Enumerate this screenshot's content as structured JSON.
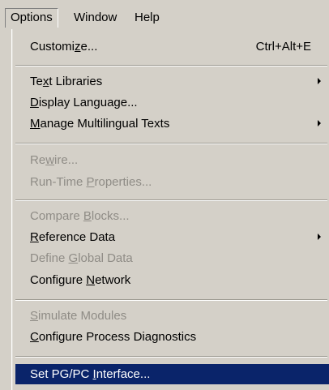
{
  "menubar": {
    "items": [
      "Options",
      "Window",
      "Help"
    ]
  },
  "menu": {
    "customize": {
      "pre": "Customi",
      "acc": "z",
      "post": "e...",
      "shortcut": "Ctrl+Alt+E"
    },
    "text_libraries": {
      "pre": "Te",
      "acc": "x",
      "post": "t Libraries"
    },
    "display_language": {
      "pre": "",
      "acc": "D",
      "post": "isplay Language..."
    },
    "manage_multilingual": {
      "pre": "",
      "acc": "M",
      "post": "anage Multilingual Texts"
    },
    "rewire": {
      "pre": "Re",
      "acc": "w",
      "post": "ire..."
    },
    "run_time_properties": {
      "pre": "Run-Time ",
      "acc": "P",
      "post": "roperties..."
    },
    "compare_blocks": {
      "pre": "Compare ",
      "acc": "B",
      "post": "locks..."
    },
    "reference_data": {
      "pre": "",
      "acc": "R",
      "post": "eference Data"
    },
    "define_global_data": {
      "pre": "Define ",
      "acc": "G",
      "post": "lobal Data"
    },
    "configure_network": {
      "pre": "Configure ",
      "acc": "N",
      "post": "etwork"
    },
    "simulate_modules": {
      "pre": "",
      "acc": "S",
      "post": "imulate Modules"
    },
    "configure_process_diagnostics": {
      "pre": "",
      "acc": "C",
      "post": "onfigure Process Diagnostics"
    },
    "set_pgpc_interface": {
      "pre": "Set PG/PC ",
      "acc": "I",
      "post": "nterface..."
    }
  }
}
